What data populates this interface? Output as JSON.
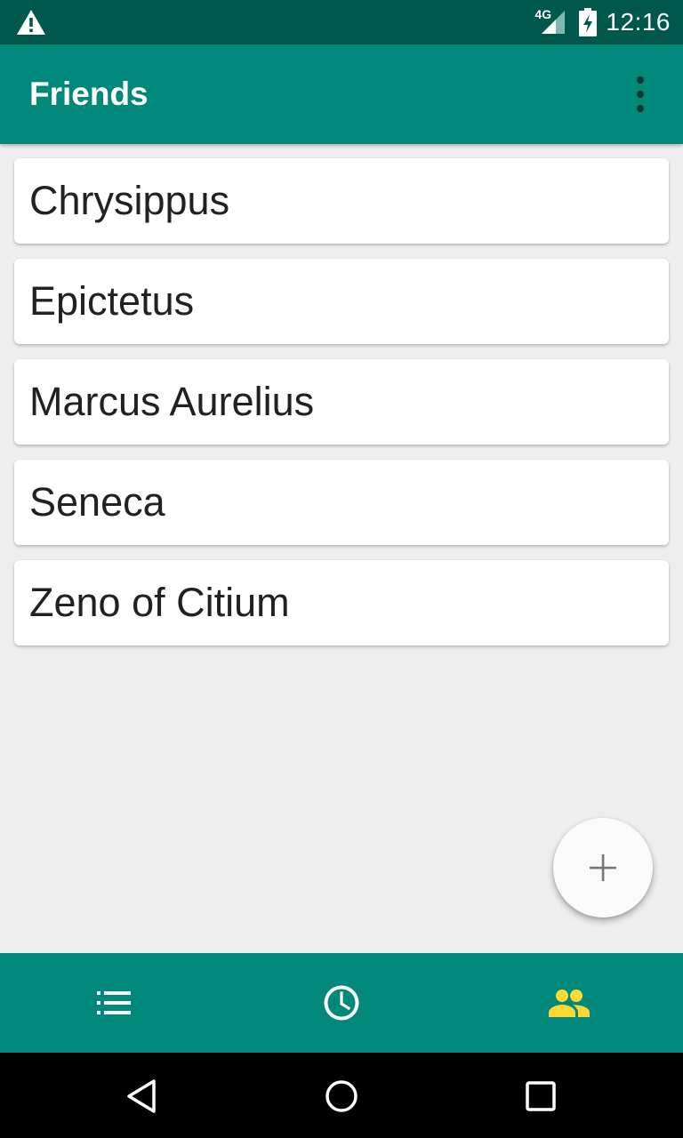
{
  "status_bar": {
    "time": "12:16",
    "network_label": "4G",
    "icons": [
      "warning-icon",
      "signal-icon",
      "battery-charging-icon"
    ],
    "background_color": "#00574b"
  },
  "app_bar": {
    "title": "Friends",
    "overflow_icon": "more-vert-icon",
    "background_color": "#00897b"
  },
  "friends": [
    {
      "name": "Chrysippus"
    },
    {
      "name": "Epictetus"
    },
    {
      "name": "Marcus Aurelius"
    },
    {
      "name": "Seneca"
    },
    {
      "name": "Zeno of Citium"
    }
  ],
  "fab": {
    "icon": "add-icon"
  },
  "bottom_nav": {
    "items": [
      {
        "icon": "list-icon",
        "selected": false
      },
      {
        "icon": "clock-icon",
        "selected": false
      },
      {
        "icon": "people-icon",
        "selected": true
      }
    ],
    "background_color": "#00897b",
    "selected_color": "#fdd835",
    "unselected_color": "#ffffff"
  },
  "system_nav": {
    "items": [
      "back-icon",
      "home-icon",
      "recents-icon"
    ]
  }
}
